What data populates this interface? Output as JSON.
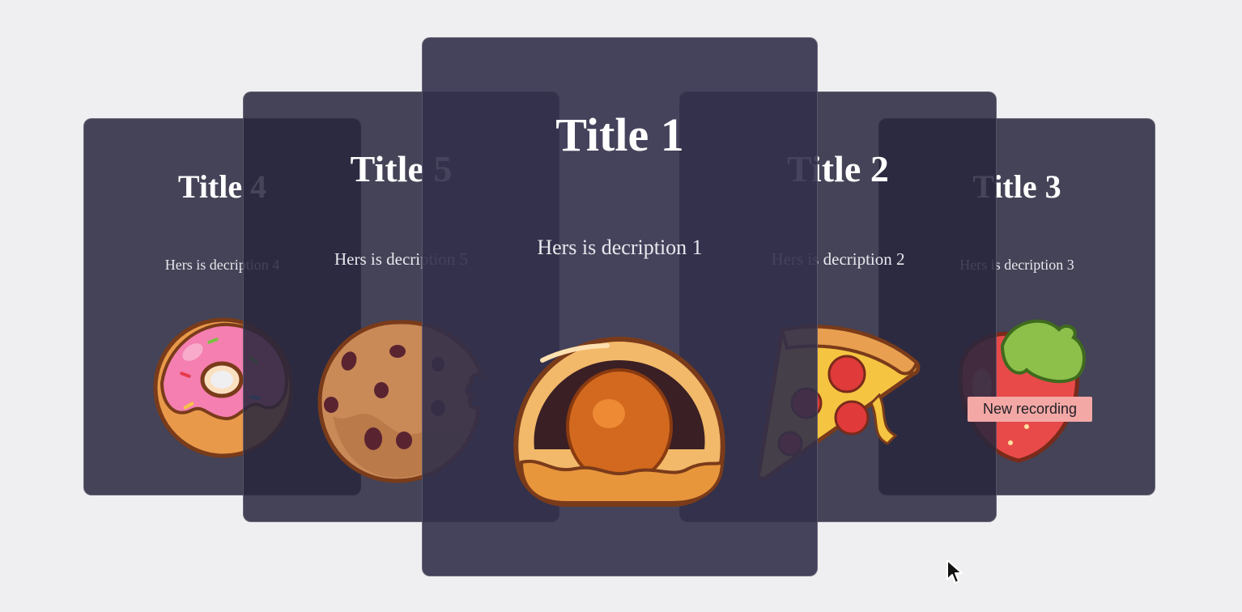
{
  "cards": {
    "card1": {
      "title": "Title 1",
      "description": "Hers is decription 1",
      "image": "egg-tart-icon"
    },
    "card2": {
      "title": "Title 2",
      "description": "Hers is decription 2",
      "image": "pizza-slice-icon"
    },
    "card3": {
      "title": "Title 3",
      "description": "Hers is decription 3",
      "image": "strawberry-icon"
    },
    "card4": {
      "title": "Title 4",
      "description": "Hers is decription 4",
      "image": "donut-icon"
    },
    "card5": {
      "title": "Title 5",
      "description": "Hers is decription 5",
      "image": "cookie-icon"
    }
  },
  "tooltip": {
    "label": "New recording"
  },
  "colors": {
    "background": "#efeff1",
    "card": "#28263e",
    "tooltip": "#f3a8a6"
  }
}
